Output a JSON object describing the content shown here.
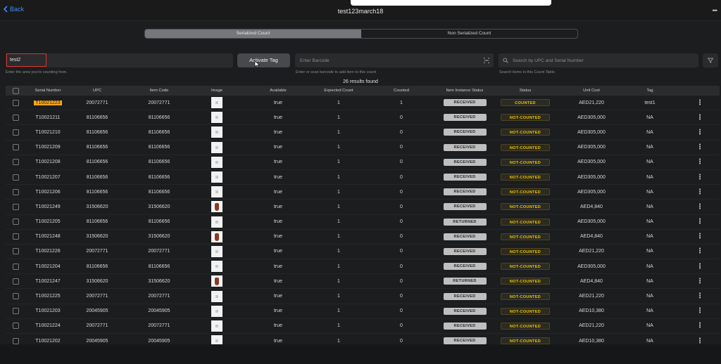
{
  "header": {
    "back_label": "Back",
    "title": "test123march18",
    "more_label": "•••"
  },
  "segments": {
    "serialized": "Serialized Count",
    "non_serialized": "Non Serialized Count"
  },
  "area": {
    "value": "test2",
    "hint": "Enter the area you're counting from."
  },
  "activate_label": "Activate Tag",
  "barcode": {
    "placeholder": "Enter Barcode",
    "hint": "Enter or scan barcode to add item to this count"
  },
  "search": {
    "placeholder": "Search by UPC and Serial Number",
    "hint": "Search items in this Count Table."
  },
  "results_text": "26 results found",
  "columns": [
    "Serial Number",
    "UPC",
    "Item Code",
    "Image",
    "Available",
    "Expected Count",
    "Counted",
    "Item Instance Status",
    "Status",
    "Unit Cost",
    "Tag"
  ],
  "rows": [
    {
      "serial": "T10021223",
      "upc": "20072771",
      "code": "20072771",
      "image": "white-product",
      "available": "true",
      "expected": "1",
      "counted": "1",
      "instance": "RECEIVED",
      "status": "COUNTED",
      "cost": "AED21,220",
      "tag": "test1"
    },
    {
      "serial": "T10021211",
      "upc": "81106656",
      "code": "81106656",
      "image": "white-product",
      "available": "true",
      "expected": "1",
      "counted": "0",
      "instance": "RECEIVED",
      "status": "NOT-COUNTED",
      "cost": "AED305,000",
      "tag": "NA"
    },
    {
      "serial": "T10021210",
      "upc": "81106656",
      "code": "81106656",
      "image": "white-product",
      "available": "true",
      "expected": "1",
      "counted": "0",
      "instance": "RECEIVED",
      "status": "NOT-COUNTED",
      "cost": "AED305,000",
      "tag": "NA"
    },
    {
      "serial": "T10021209",
      "upc": "81106656",
      "code": "81106656",
      "image": "white-product",
      "available": "true",
      "expected": "1",
      "counted": "0",
      "instance": "RECEIVED",
      "status": "NOT-COUNTED",
      "cost": "AED305,000",
      "tag": "NA"
    },
    {
      "serial": "T10021208",
      "upc": "81106656",
      "code": "81106656",
      "image": "white-product",
      "available": "true",
      "expected": "1",
      "counted": "0",
      "instance": "RECEIVED",
      "status": "NOT-COUNTED",
      "cost": "AED305,000",
      "tag": "NA"
    },
    {
      "serial": "T10021207",
      "upc": "81106656",
      "code": "81106656",
      "image": "white-product",
      "available": "true",
      "expected": "1",
      "counted": "0",
      "instance": "RECEIVED",
      "status": "NOT-COUNTED",
      "cost": "AED305,000",
      "tag": "NA"
    },
    {
      "serial": "T10021206",
      "upc": "81106656",
      "code": "81106656",
      "image": "white-product",
      "available": "true",
      "expected": "1",
      "counted": "0",
      "instance": "RECEIVED",
      "status": "NOT-COUNTED",
      "cost": "AED305,000",
      "tag": "NA"
    },
    {
      "serial": "T10021249",
      "upc": "31506620",
      "code": "31506620",
      "image": "vase",
      "available": "true",
      "expected": "1",
      "counted": "0",
      "instance": "RECEIVED",
      "status": "NOT-COUNTED",
      "cost": "AED4,840",
      "tag": "NA"
    },
    {
      "serial": "T10021205",
      "upc": "81106656",
      "code": "81106656",
      "image": "white-product",
      "available": "true",
      "expected": "1",
      "counted": "0",
      "instance": "RETURNED",
      "status": "NOT-COUNTED",
      "cost": "AED305,000",
      "tag": "NA"
    },
    {
      "serial": "T10021248",
      "upc": "31506620",
      "code": "31506620",
      "image": "vase",
      "available": "true",
      "expected": "1",
      "counted": "0",
      "instance": "RECEIVED",
      "status": "NOT-COUNTED",
      "cost": "AED4,840",
      "tag": "NA"
    },
    {
      "serial": "T10021226",
      "upc": "20072771",
      "code": "20072771",
      "image": "white-product",
      "available": "true",
      "expected": "1",
      "counted": "0",
      "instance": "RECEIVED",
      "status": "NOT-COUNTED",
      "cost": "AED21,220",
      "tag": "NA"
    },
    {
      "serial": "T10021204",
      "upc": "81106656",
      "code": "81106656",
      "image": "white-product",
      "available": "true",
      "expected": "1",
      "counted": "0",
      "instance": "RECEIVED",
      "status": "NOT-COUNTED",
      "cost": "AED305,000",
      "tag": "NA"
    },
    {
      "serial": "T10021247",
      "upc": "31506620",
      "code": "31506620",
      "image": "vase",
      "available": "true",
      "expected": "1",
      "counted": "0",
      "instance": "RETURNED",
      "status": "NOT-COUNTED",
      "cost": "AED4,840",
      "tag": "NA"
    },
    {
      "serial": "T10021225",
      "upc": "20072771",
      "code": "20072771",
      "image": "white-product",
      "available": "true",
      "expected": "1",
      "counted": "0",
      "instance": "RECEIVED",
      "status": "NOT-COUNTED",
      "cost": "AED21,220",
      "tag": "NA"
    },
    {
      "serial": "T10021203",
      "upc": "20045905",
      "code": "20045905",
      "image": "white-product",
      "available": "true",
      "expected": "1",
      "counted": "0",
      "instance": "RECEIVED",
      "status": "NOT-COUNTED",
      "cost": "AED10,380",
      "tag": "NA"
    },
    {
      "serial": "T10021224",
      "upc": "20072771",
      "code": "20072771",
      "image": "white-product",
      "available": "true",
      "expected": "1",
      "counted": "0",
      "instance": "RECEIVED",
      "status": "NOT-COUNTED",
      "cost": "AED21,220",
      "tag": "NA"
    },
    {
      "serial": "T10021202",
      "upc": "20045905",
      "code": "20045905",
      "image": "white-product",
      "available": "true",
      "expected": "1",
      "counted": "0",
      "instance": "RECEIVED",
      "status": "NOT-COUNTED",
      "cost": "AED10,380",
      "tag": "NA"
    }
  ],
  "colors": {
    "accent_blue": "#3d8bff",
    "highlight_orange": "#f5a623",
    "status_yellow": "#f2c200",
    "red_outline": "#e0322e"
  }
}
